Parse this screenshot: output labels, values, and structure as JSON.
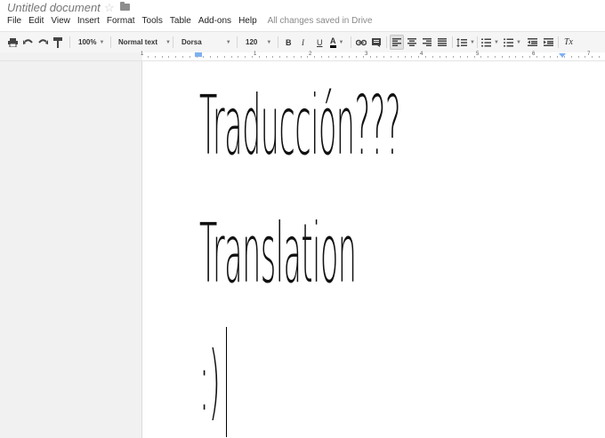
{
  "title_bar": {
    "doc_title": "Untitled document",
    "star_icon": "☆"
  },
  "menu": {
    "items": [
      "File",
      "Edit",
      "View",
      "Insert",
      "Format",
      "Tools",
      "Table",
      "Add-ons",
      "Help"
    ],
    "save_status": "All changes saved in Drive"
  },
  "toolbar": {
    "zoom": "100%",
    "style": "Normal text",
    "font": "Dorsa",
    "size": "120",
    "bold": "B",
    "italic": "I",
    "underline": "U",
    "text_color": "A",
    "clear_format": "Tx"
  },
  "ruler": {
    "numbers": [
      "1",
      "1",
      "2",
      "3",
      "4",
      "5",
      "6",
      "7"
    ]
  },
  "document": {
    "lines": [
      "Traducción???",
      "Translation",
      ":)"
    ]
  },
  "colors": {
    "toolbar_bg": "#f5f5f5",
    "gutter_bg": "#f1f1f1",
    "indent_marker": "#7fb0f0"
  }
}
